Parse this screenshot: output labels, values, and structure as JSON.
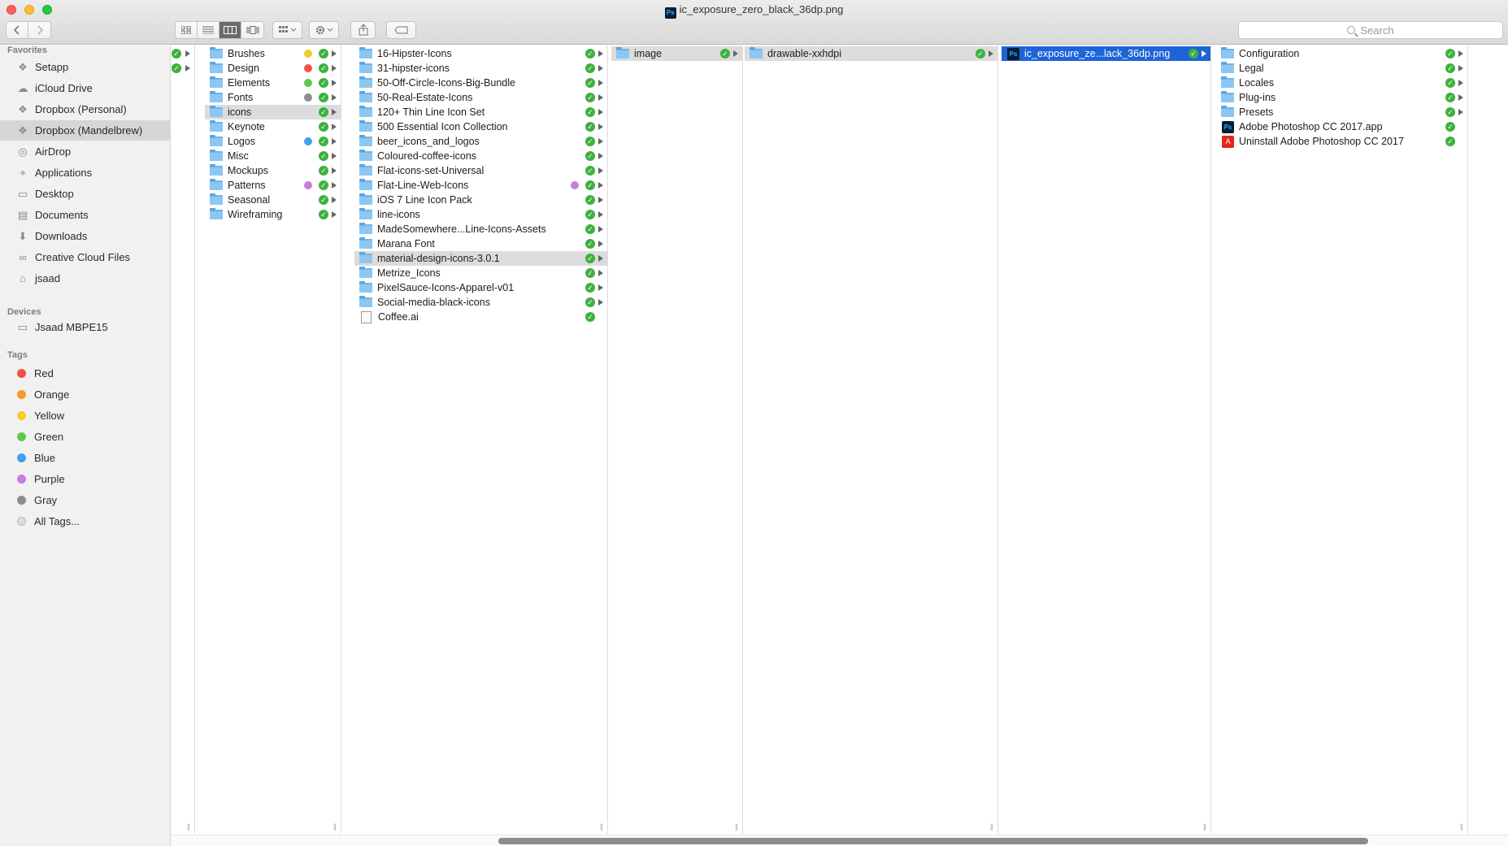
{
  "window": {
    "title": "ic_exposure_zero_black_36dp.png"
  },
  "toolbar": {
    "back_icon": "chevron-left-icon",
    "forward_icon": "chevron-right-icon",
    "view_modes": [
      "icon-view-icon",
      "list-view-icon",
      "column-view-icon",
      "cover-flow-icon"
    ],
    "active_view": "column-view-icon",
    "search_placeholder": "Search"
  },
  "sidebar": {
    "favorites_header": "Favorites",
    "favorites": [
      {
        "label": "Setapp",
        "icon": "setapp-icon"
      },
      {
        "label": "iCloud Drive",
        "icon": "cloud-icon"
      },
      {
        "label": "Dropbox (Personal)",
        "icon": "dropbox-icon"
      },
      {
        "label": "Dropbox (Mandelbrew)",
        "icon": "dropbox-icon",
        "selected": true
      },
      {
        "label": "AirDrop",
        "icon": "airdrop-icon"
      },
      {
        "label": "Applications",
        "icon": "applications-icon"
      },
      {
        "label": "Desktop",
        "icon": "desktop-icon"
      },
      {
        "label": "Documents",
        "icon": "documents-icon"
      },
      {
        "label": "Downloads",
        "icon": "downloads-icon"
      },
      {
        "label": "Creative Cloud Files",
        "icon": "creative-cloud-icon"
      },
      {
        "label": "jsaad",
        "icon": "home-icon"
      }
    ],
    "devices_header": "Devices",
    "devices": [
      {
        "label": "Jsaad MBPE15",
        "icon": "laptop-icon"
      }
    ],
    "tags_header": "Tags",
    "tags": [
      {
        "label": "Red",
        "color": "#f0504a"
      },
      {
        "label": "Orange",
        "color": "#f89a2c"
      },
      {
        "label": "Yellow",
        "color": "#f7cb2e"
      },
      {
        "label": "Green",
        "color": "#5ec94a"
      },
      {
        "label": "Blue",
        "color": "#3ea1ef"
      },
      {
        "label": "Purple",
        "color": "#c67ee0"
      },
      {
        "label": "Gray",
        "color": "#8e8e8e"
      },
      {
        "label": "All Tags...",
        "color": "#dcdcdc"
      }
    ]
  },
  "columns": [
    {
      "items": [
        {
          "label": "",
          "type": "none"
        },
        {
          "label": "",
          "type": "none"
        }
      ]
    },
    {
      "items": [
        {
          "label": "Brushes",
          "tag": "#f7cb2e"
        },
        {
          "label": "Design",
          "tag": "#f0504a"
        },
        {
          "label": "Elements",
          "tag": "#5ec94a"
        },
        {
          "label": "Fonts",
          "tag": "#8e8e8e"
        },
        {
          "label": "icons",
          "selected": true
        },
        {
          "label": "Keynote"
        },
        {
          "label": "Logos",
          "tag": "#3ea1ef"
        },
        {
          "label": "Misc"
        },
        {
          "label": "Mockups"
        },
        {
          "label": "Patterns",
          "tag": "#c67ee0"
        },
        {
          "label": "Seasonal"
        },
        {
          "label": "Wireframing"
        }
      ]
    },
    {
      "items": [
        {
          "label": "16-Hipster-Icons"
        },
        {
          "label": "31-hipster-icons"
        },
        {
          "label": "50-Off-Circle-Icons-Big-Bundle"
        },
        {
          "label": "50-Real-Estate-Icons"
        },
        {
          "label": "120+ Thin Line Icon Set"
        },
        {
          "label": "500 Essential Icon Collection"
        },
        {
          "label": "beer_icons_and_logos"
        },
        {
          "label": "Coloured-coffee-icons"
        },
        {
          "label": "Flat-icons-set-Universal"
        },
        {
          "label": "Flat-Line-Web-Icons",
          "tag": "#c67ee0"
        },
        {
          "label": "iOS 7 Line Icon Pack"
        },
        {
          "label": "line-icons"
        },
        {
          "label": "MadeSomewhere...Line-Icons-Assets"
        },
        {
          "label": "Marana Font"
        },
        {
          "label": "material-design-icons-3.0.1",
          "selected": true
        },
        {
          "label": "Metrize_Icons"
        },
        {
          "label": "PixelSauce-Icons-Apparel-v01"
        },
        {
          "label": "Social-media-black-icons"
        },
        {
          "label": "Coffee.ai",
          "type": "file"
        }
      ]
    },
    {
      "items": [
        {
          "label": "image",
          "selected": true
        }
      ]
    },
    {
      "items": [
        {
          "label": "drawable-xxhdpi",
          "selected": true
        }
      ]
    },
    {
      "items": [
        {
          "label": "ic_exposure_ze...lack_36dp.png",
          "type": "ps",
          "active": true
        }
      ]
    },
    {
      "items": [
        {
          "label": "Configuration"
        },
        {
          "label": "Legal"
        },
        {
          "label": "Locales"
        },
        {
          "label": "Plug-ins"
        },
        {
          "label": "Presets"
        },
        {
          "label": "Adobe Photoshop CC 2017.app",
          "type": "ps",
          "noarrow": true
        },
        {
          "label": "Uninstall Adobe Photoshop CC 2017",
          "type": "adobe",
          "noarrow": true
        }
      ]
    }
  ],
  "scroll": {
    "horizontal_position": 0.7
  }
}
